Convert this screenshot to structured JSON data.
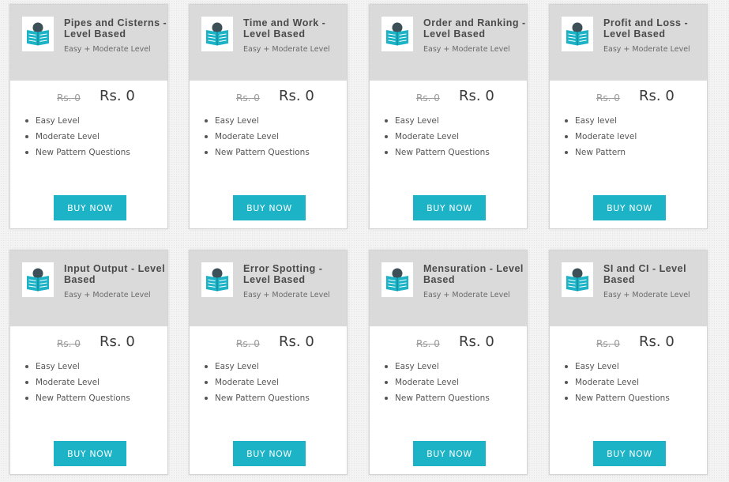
{
  "colors": {
    "button": "#1cb3c7",
    "card_header": "#d9dad9",
    "icon_teal": "#1cb3c7",
    "icon_dark": "#3d4f57"
  },
  "cards": [
    {
      "title": "Pipes and Cisterns - Level Based",
      "subtitle": "Easy + Moderate Level",
      "old_price": "Rs. 0",
      "new_price": "Rs. 0",
      "features": [
        "Easy Level",
        "Moderate Level",
        "New Pattern Questions"
      ],
      "button_label": "BUY NOW",
      "icon": "book-reader-icon"
    },
    {
      "title": "Time and Work - Level Based",
      "subtitle": "Easy + Moderate Level",
      "old_price": "Rs. 0",
      "new_price": "Rs. 0",
      "features": [
        "Easy Level",
        "Moderate Level",
        "New Pattern Questions"
      ],
      "button_label": "BUY NOW",
      "icon": "book-reader-icon"
    },
    {
      "title": "Order and Ranking - Level Based",
      "subtitle": "Easy + Moderate Level",
      "old_price": "Rs. 0",
      "new_price": "Rs. 0",
      "features": [
        "Easy Level",
        "Moderate Level",
        "New Pattern Questions"
      ],
      "button_label": "BUY NOW",
      "icon": "book-reader-icon"
    },
    {
      "title": "Profit and Loss - Level Based",
      "subtitle": "Easy + Moderate Level",
      "old_price": "Rs. 0",
      "new_price": "Rs. 0",
      "features": [
        "Easy level",
        "Moderate level",
        "New Pattern"
      ],
      "button_label": "BUY NOW",
      "icon": "book-reader-icon"
    },
    {
      "title": "Input Output - Level Based",
      "subtitle": "Easy + Moderate Level",
      "old_price": "Rs. 0",
      "new_price": "Rs. 0",
      "features": [
        "Easy Level",
        "Moderate Level",
        "New Pattern Questions"
      ],
      "button_label": "BUY NOW",
      "icon": "book-reader-icon"
    },
    {
      "title": "Error Spotting - Level Based",
      "subtitle": "Easy + Moderate Level",
      "old_price": "Rs. 0",
      "new_price": "Rs. 0",
      "features": [
        "Easy Level",
        "Moderate Level",
        "New Pattern Questions"
      ],
      "button_label": "BUY NOW",
      "icon": "book-reader-icon"
    },
    {
      "title": "Mensuration - Level Based",
      "subtitle": "Easy + Moderate Level",
      "old_price": "Rs. 0",
      "new_price": "Rs. 0",
      "features": [
        "Easy Level",
        "Moderate Level",
        "New Pattern Questions"
      ],
      "button_label": "BUY NOW",
      "icon": "book-reader-icon"
    },
    {
      "title": "SI and CI - Level Based",
      "subtitle": "Easy + Moderate Level",
      "old_price": "Rs. 0",
      "new_price": "Rs. 0",
      "features": [
        "Easy Level",
        "Moderate Level",
        "New Pattern Questions"
      ],
      "button_label": "BUY NOW",
      "icon": "book-reader-icon"
    }
  ]
}
